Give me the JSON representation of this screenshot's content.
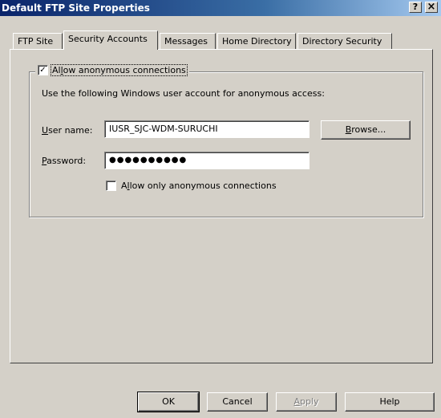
{
  "window": {
    "title": "Default FTP Site Properties",
    "help_glyph": "?",
    "close_glyph": "×"
  },
  "tabs": [
    {
      "label": "FTP Site"
    },
    {
      "label": "Security Accounts",
      "active": true
    },
    {
      "label": "Messages"
    },
    {
      "label": "Home Directory"
    },
    {
      "label": "Directory Security"
    }
  ],
  "anon_group": {
    "checkbox_label": "Allow anonymous connections",
    "checked": true,
    "description": "Use the following Windows user account for anonymous access:",
    "username_label": "User name:",
    "username_value": "IUSR_SJC-WDM-SURUCHI",
    "browse_label": "Browse...",
    "password_label": "Password:",
    "password_value": "●●●●●●●●●●",
    "only_anon_label": "Allow only anonymous connections",
    "only_anon_checked": false
  },
  "footer": {
    "ok_label": "OK",
    "cancel_label": "Cancel",
    "apply_label": "Apply",
    "apply_enabled": false,
    "help_label": "Help"
  }
}
